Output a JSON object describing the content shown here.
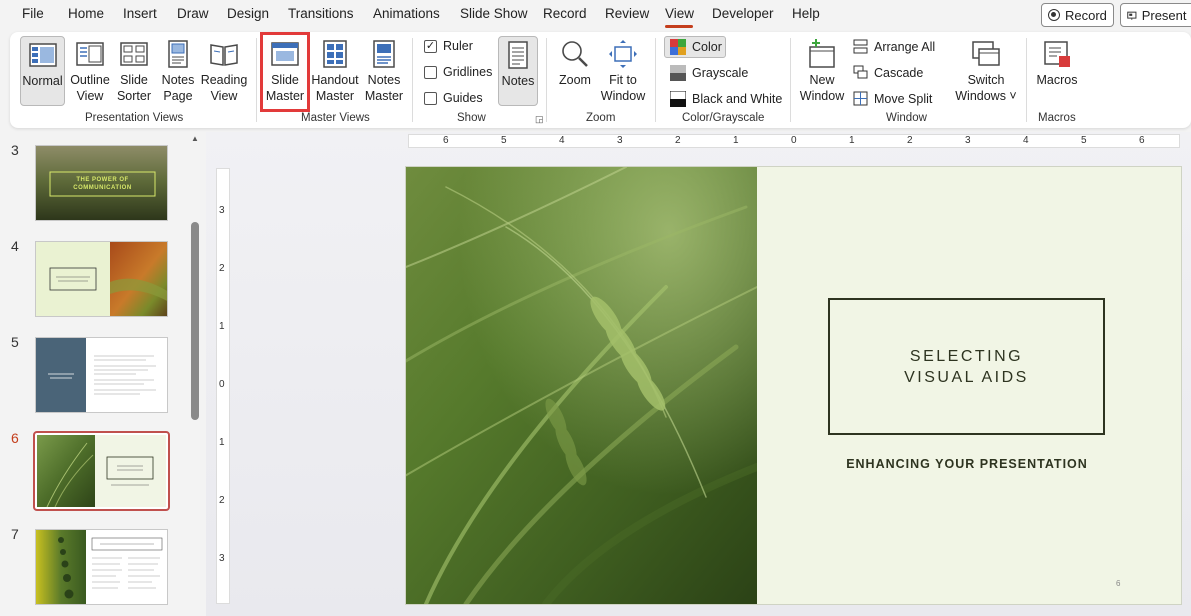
{
  "menu": {
    "items": [
      "File",
      "Home",
      "Insert",
      "Draw",
      "Design",
      "Transitions",
      "Animations",
      "Slide Show",
      "Record",
      "Review",
      "View",
      "Developer",
      "Help"
    ],
    "active": "View",
    "record_button": "Record",
    "present_button": "Present i"
  },
  "ribbon": {
    "presentation_views": {
      "label": "Presentation Views",
      "normal": "Normal",
      "outline_line1": "Outline",
      "outline_line2": "View",
      "sorter_line1": "Slide",
      "sorter_line2": "Sorter",
      "notes_page_line1": "Notes",
      "notes_page_line2": "Page",
      "reading_line1": "Reading",
      "reading_line2": "View"
    },
    "master_views": {
      "label": "Master Views",
      "slide_master_line1": "Slide",
      "slide_master_line2": "Master",
      "handout_line1": "Handout",
      "handout_line2": "Master",
      "notes_master_line1": "Notes",
      "notes_master_line2": "Master"
    },
    "show": {
      "label": "Show",
      "ruler": "Ruler",
      "ruler_checked": true,
      "gridlines": "Gridlines",
      "gridlines_checked": false,
      "guides": "Guides",
      "guides_checked": false,
      "notes": "Notes"
    },
    "zoom": {
      "label": "Zoom",
      "zoom": "Zoom",
      "fit_line1": "Fit to",
      "fit_line2": "Window"
    },
    "color_grayscale": {
      "label": "Color/Grayscale",
      "color": "Color",
      "grayscale": "Grayscale",
      "bw": "Black and White"
    },
    "window": {
      "label": "Window",
      "new_line1": "New",
      "new_line2": "Window",
      "arrange_all": "Arrange All",
      "cascade": "Cascade",
      "move_split": "Move Split",
      "switch_line1": "Switch",
      "switch_line2": "Windows ˅"
    },
    "macros": {
      "label": "Macros",
      "macros": "Macros"
    }
  },
  "slides": {
    "numbers": [
      "3",
      "4",
      "5",
      "6",
      "7"
    ],
    "current": "6",
    "thumb3_title": "THE POWER OF COMMUNICATION"
  },
  "rulers": {
    "horizontal": [
      "6",
      "5",
      "4",
      "3",
      "2",
      "1",
      "0",
      "1",
      "2",
      "3",
      "4",
      "5",
      "6"
    ],
    "vertical": [
      "3",
      "2",
      "1",
      "0",
      "1",
      "2",
      "3"
    ]
  },
  "slide": {
    "title_line1": "SELECTING",
    "title_line2": "VISUAL AIDS",
    "subtitle": "ENHANCING YOUR PRESENTATION",
    "page_number": "6"
  },
  "colors": {
    "accent": "#c43e1c",
    "highlight": "#e23a3a",
    "slide_bg": "#f1f5e5",
    "slide_text": "#2e3420"
  }
}
